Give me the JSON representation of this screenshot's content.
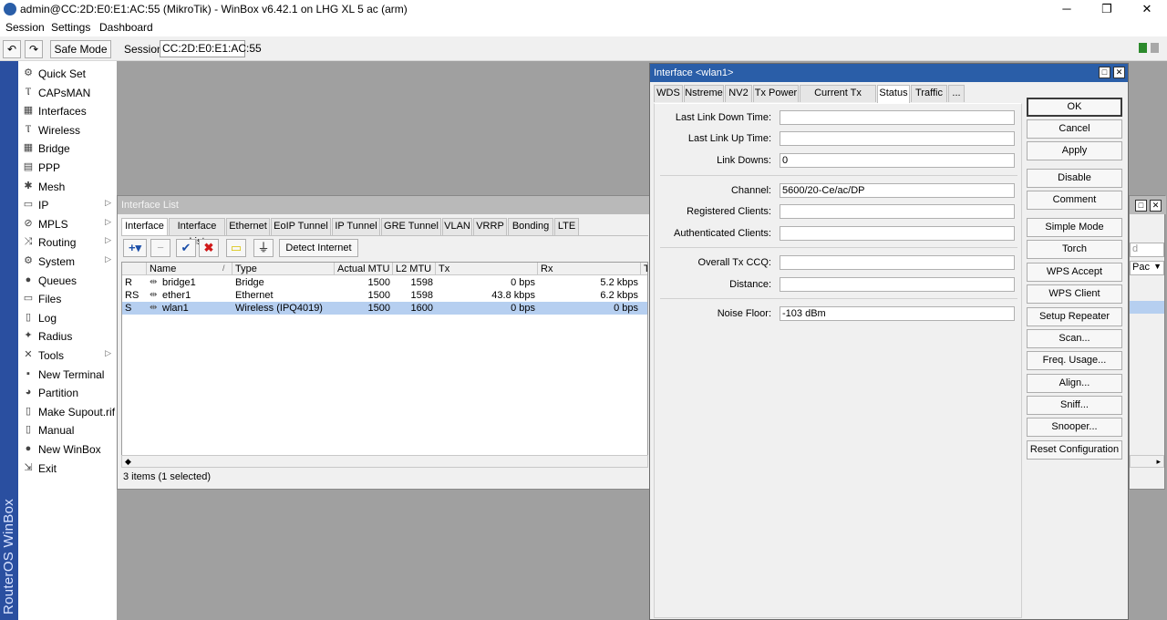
{
  "window": {
    "title": "admin@CC:2D:E0:E1:AC:55 (MikroTik) - WinBox v6.42.1 on LHG XL 5 ac (arm)",
    "minimize": "─",
    "restore": "❐",
    "close": "✕"
  },
  "menu": {
    "session": "Session",
    "settings": "Settings",
    "dashboard": "Dashboard"
  },
  "toolbar": {
    "undo": "↶",
    "redo": "↷",
    "safe_mode": "Safe Mode",
    "session_label": "Session:",
    "session_value": "CC:2D:E0:E1:AC:55"
  },
  "brand": "RouterOS WinBox",
  "sidebar": {
    "items": [
      {
        "label": "Quick Set",
        "icon": "quickset-icon",
        "glyph": "⚙",
        "submenu": false
      },
      {
        "label": "CAPsMAN",
        "icon": "capsman-icon",
        "glyph": "Ⲧ",
        "submenu": false
      },
      {
        "label": "Interfaces",
        "icon": "interfaces-icon",
        "glyph": "▦",
        "submenu": false
      },
      {
        "label": "Wireless",
        "icon": "wireless-icon",
        "glyph": "Ⲧ",
        "submenu": false
      },
      {
        "label": "Bridge",
        "icon": "bridge-icon",
        "glyph": "▦",
        "submenu": false
      },
      {
        "label": "PPP",
        "icon": "ppp-icon",
        "glyph": "▤",
        "submenu": false
      },
      {
        "label": "Mesh",
        "icon": "mesh-icon",
        "glyph": "✱",
        "submenu": false
      },
      {
        "label": "IP",
        "icon": "ip-icon",
        "glyph": "▭",
        "submenu": true
      },
      {
        "label": "MPLS",
        "icon": "mpls-icon",
        "glyph": "⊘",
        "submenu": true
      },
      {
        "label": "Routing",
        "icon": "routing-icon",
        "glyph": "⤨",
        "submenu": true
      },
      {
        "label": "System",
        "icon": "system-icon",
        "glyph": "⚙",
        "submenu": true
      },
      {
        "label": "Queues",
        "icon": "queues-icon",
        "glyph": "●",
        "submenu": false
      },
      {
        "label": "Files",
        "icon": "files-icon",
        "glyph": "▭",
        "submenu": false
      },
      {
        "label": "Log",
        "icon": "log-icon",
        "glyph": "▯",
        "submenu": false
      },
      {
        "label": "Radius",
        "icon": "radius-icon",
        "glyph": "✦",
        "submenu": false
      },
      {
        "label": "Tools",
        "icon": "tools-icon",
        "glyph": "✕",
        "submenu": true
      },
      {
        "label": "New Terminal",
        "icon": "terminal-icon",
        "glyph": "▪",
        "submenu": false
      },
      {
        "label": "Partition",
        "icon": "partition-icon",
        "glyph": "◕",
        "submenu": false
      },
      {
        "label": "Make Supout.rif",
        "icon": "supout-icon",
        "glyph": "▯",
        "submenu": false
      },
      {
        "label": "Manual",
        "icon": "manual-icon",
        "glyph": "▯",
        "submenu": false
      },
      {
        "label": "New WinBox",
        "icon": "winbox-icon",
        "glyph": "●",
        "submenu": false
      },
      {
        "label": "Exit",
        "icon": "exit-icon",
        "glyph": "⇲",
        "submenu": false
      }
    ]
  },
  "interface_list": {
    "title": "Interface List",
    "tabs": [
      "Interface",
      "Interface List",
      "Ethernet",
      "EoIP Tunnel",
      "IP Tunnel",
      "GRE Tunnel",
      "VLAN",
      "VRRP",
      "Bonding",
      "LTE"
    ],
    "detect_internet": "Detect Internet",
    "columns": [
      "",
      "Name",
      "Type",
      "Actual MTU",
      "L2 MTU",
      "Tx",
      "Rx",
      "T"
    ],
    "rows": [
      {
        "flags": "R",
        "name": "bridge1",
        "type": "Bridge",
        "actual_mtu": "1500",
        "l2_mtu": "1598",
        "tx": "0 bps",
        "rx": "5.2 kbps",
        "icon": "⇹"
      },
      {
        "flags": "RS",
        "name": "ether1",
        "type": "Ethernet",
        "actual_mtu": "1500",
        "l2_mtu": "1598",
        "tx": "43.8 kbps",
        "rx": "6.2 kbps",
        "icon": "⇹"
      },
      {
        "flags": "S",
        "name": "wlan1",
        "type": "Wireless (IPQ4019)",
        "actual_mtu": "1500",
        "l2_mtu": "1600",
        "tx": "0 bps",
        "rx": "0 bps",
        "icon": "⇹"
      }
    ],
    "status": "3 items (1 selected)"
  },
  "dialog": {
    "title": "Interface <wlan1>",
    "tabs": [
      "WDS",
      "Nstreme",
      "NV2",
      "Tx Power",
      "Current Tx Power",
      "Status",
      "Traffic",
      "..."
    ],
    "fields": {
      "last_link_down_time": {
        "label": "Last Link Down Time:",
        "value": ""
      },
      "last_link_up_time": {
        "label": "Last Link Up Time:",
        "value": ""
      },
      "link_downs": {
        "label": "Link Downs:",
        "value": "0"
      },
      "channel": {
        "label": "Channel:",
        "value": "5600/20-Ce/ac/DP"
      },
      "registered_clients": {
        "label": "Registered Clients:",
        "value": ""
      },
      "authenticated_clients": {
        "label": "Authenticated Clients:",
        "value": ""
      },
      "overall_tx_ccq": {
        "label": "Overall Tx CCQ:",
        "value": ""
      },
      "distance": {
        "label": "Distance:",
        "value": ""
      },
      "noise_floor": {
        "label": "Noise Floor:",
        "value": "-103 dBm"
      }
    },
    "buttons": [
      "OK",
      "Cancel",
      "Apply",
      "Disable",
      "Comment",
      "Simple Mode",
      "Torch",
      "WPS Accept",
      "WPS Client",
      "Setup Repeater",
      "Scan...",
      "Freq. Usage...",
      "Align...",
      "Sniff...",
      "Snooper...",
      "Reset Configuration"
    ]
  },
  "hidden_window": {
    "col_label": "Pac",
    "field_fragment": "d"
  },
  "colors": {
    "brand_blue": "#2a4fa0",
    "title_blue": "#2a5ea8",
    "selected_row": "#b6cff0",
    "workspace": "#a0a0a0"
  }
}
